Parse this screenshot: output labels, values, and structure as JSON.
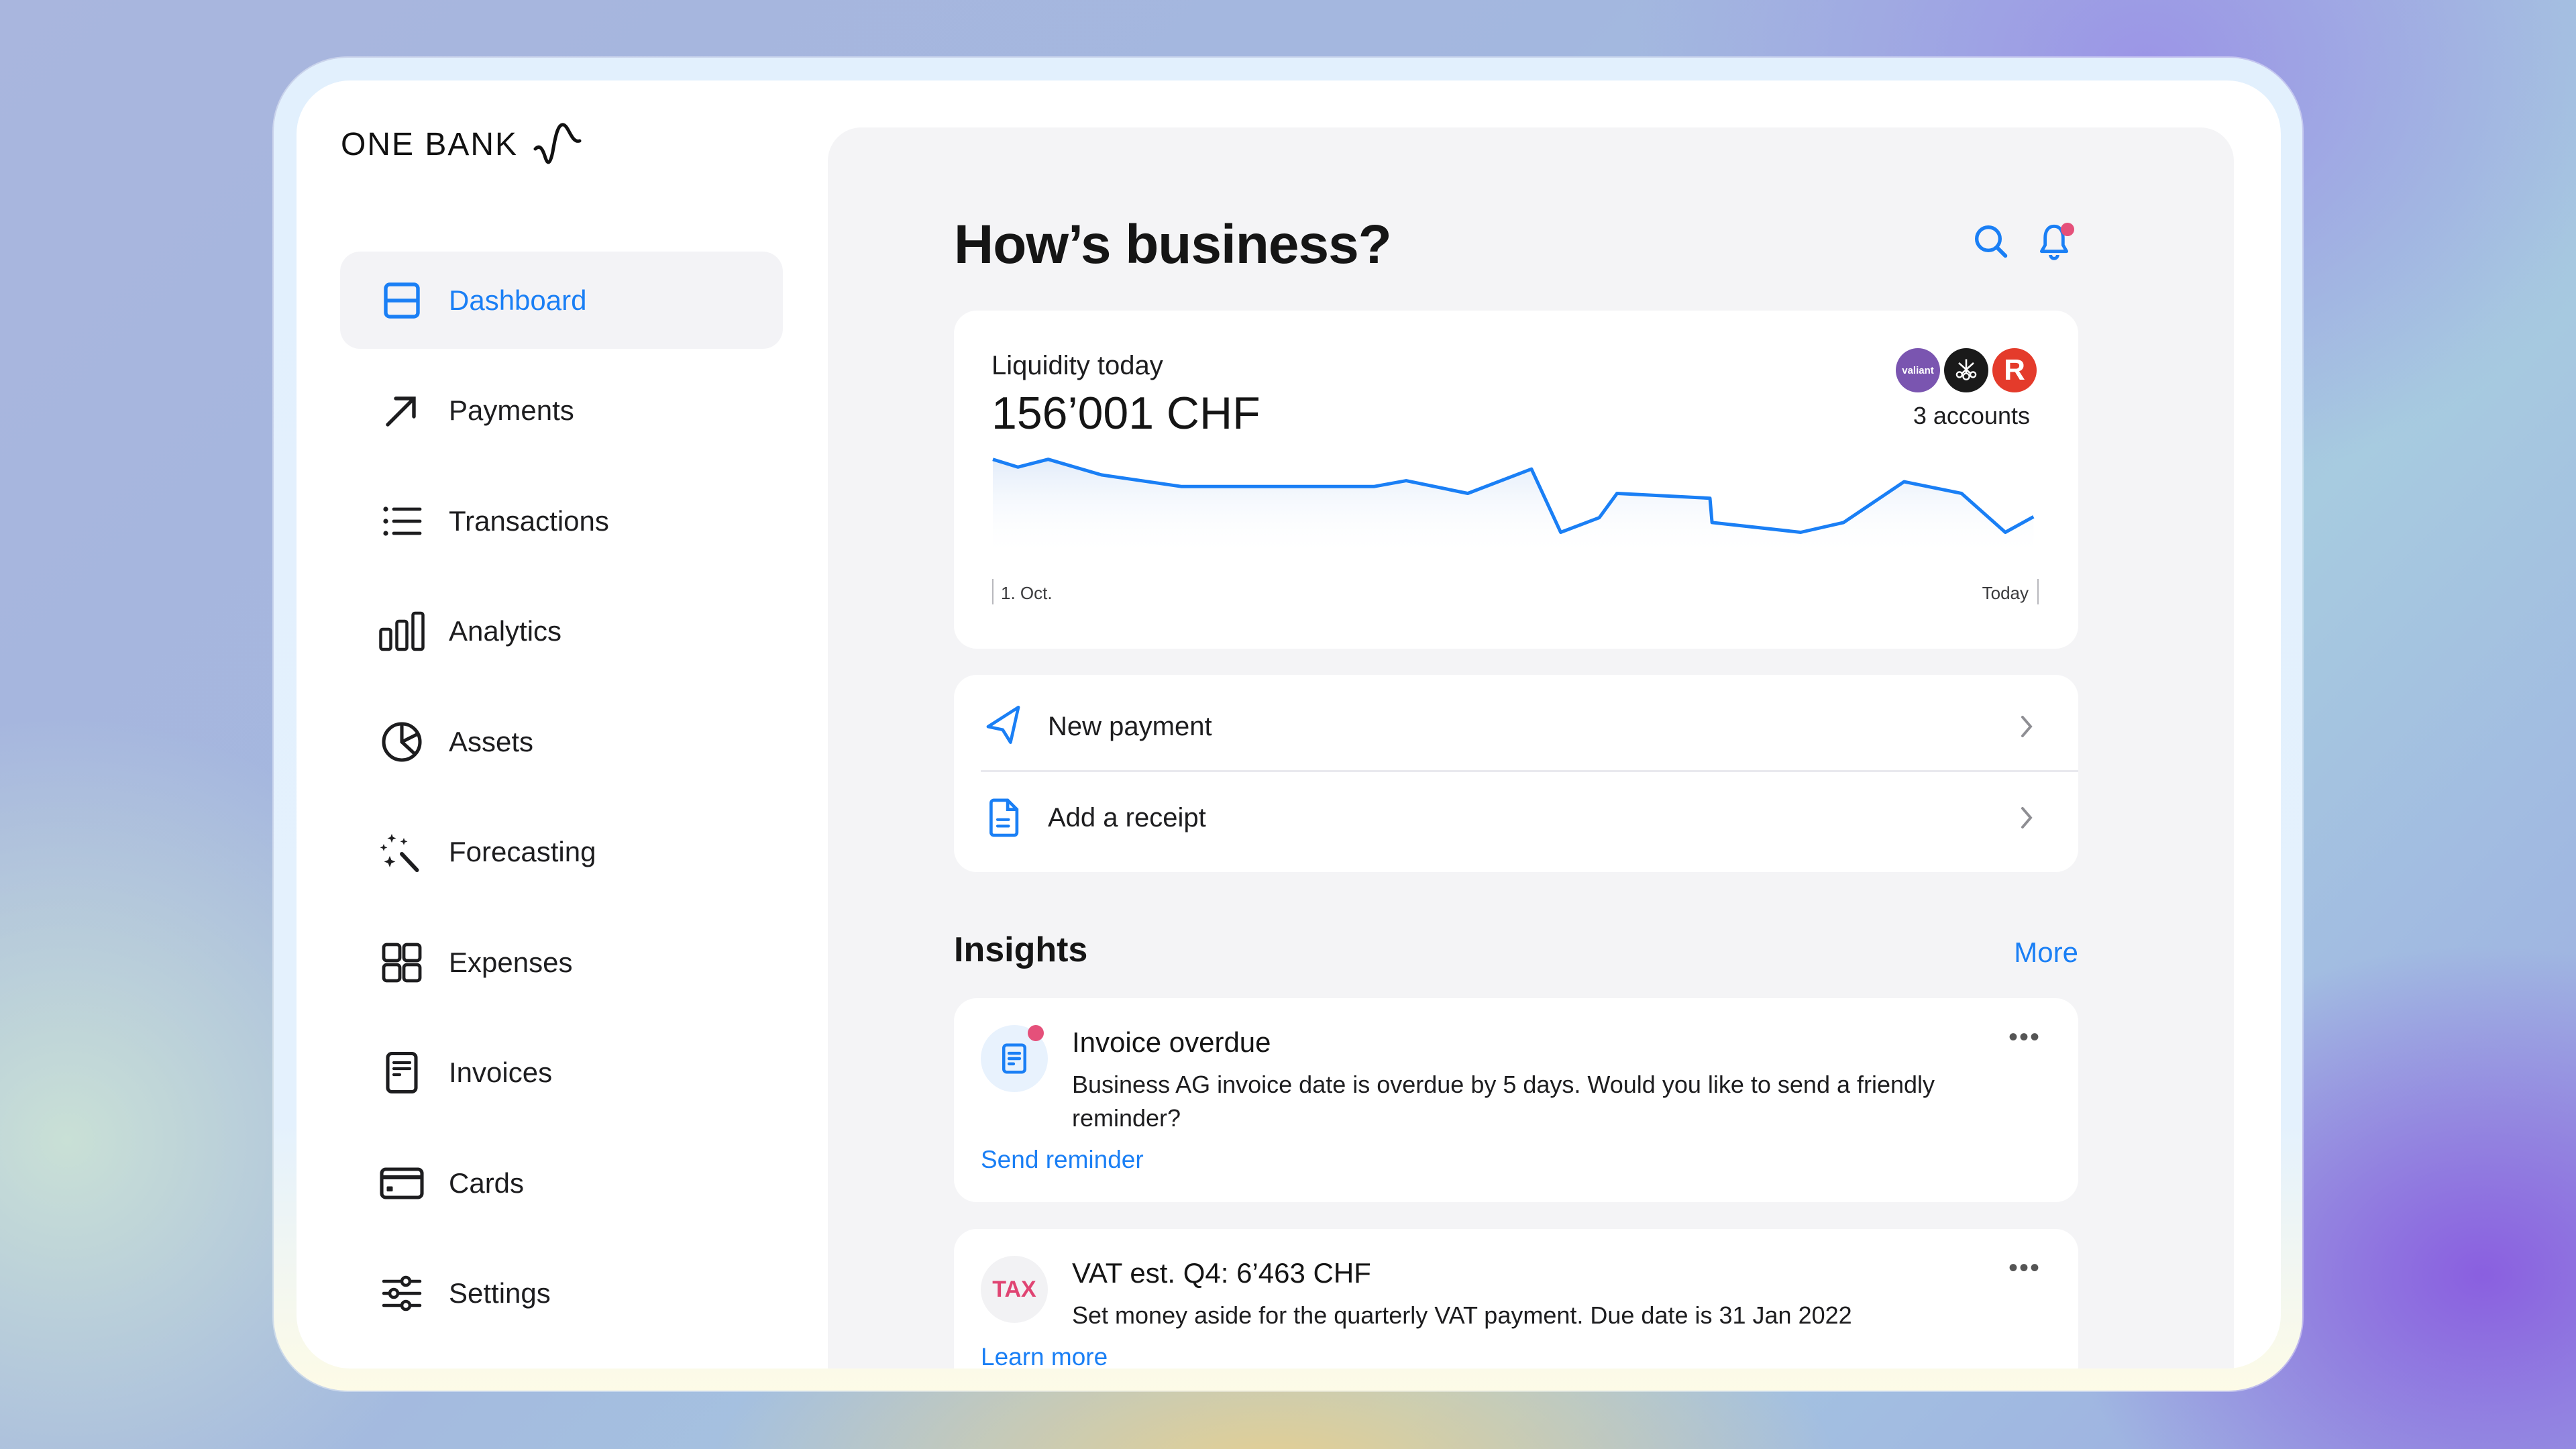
{
  "app": {
    "brand": "ONE BANK"
  },
  "sidebar": {
    "items": [
      {
        "label": "Dashboard",
        "icon": "dashboard-icon",
        "active": true
      },
      {
        "label": "Payments",
        "icon": "arrow-up-right-icon"
      },
      {
        "label": "Transactions",
        "icon": "list-icon"
      },
      {
        "label": "Analytics",
        "icon": "bar-chart-icon"
      },
      {
        "label": "Assets",
        "icon": "pie-chart-icon"
      },
      {
        "label": "Forecasting",
        "icon": "magic-wand-icon"
      },
      {
        "label": "Expenses",
        "icon": "grid-icon"
      },
      {
        "label": "Invoices",
        "icon": "document-icon"
      },
      {
        "label": "Cards",
        "icon": "credit-card-icon"
      },
      {
        "label": "Settings",
        "icon": "sliders-icon"
      }
    ]
  },
  "header": {
    "title": "How’s business?"
  },
  "liquidity": {
    "label": "Liquidity today",
    "value": "156’001 CHF",
    "accounts_label": "3 accounts",
    "banks": [
      {
        "name": "valiant",
        "label": "valiant",
        "color": "#7a55b0"
      },
      {
        "name": "ubs",
        "label": "",
        "color": "#1a1a1a"
      },
      {
        "name": "raiffeisen",
        "label": "R",
        "color": "#e43b2b"
      }
    ]
  },
  "chart_data": {
    "type": "area",
    "title": "Liquidity today",
    "x_start_label": "1. Oct.",
    "x_end_label": "Today",
    "xlabel": "",
    "ylabel": "",
    "grid": false,
    "ylim": [
      0,
      100
    ],
    "x": [
      0,
      2.4,
      5.3,
      10.4,
      18.1,
      36.5,
      39.6,
      45.5,
      51.6,
      54.4,
      58.1,
      59.8,
      68.7,
      68.9,
      77.4,
      81.5,
      87.3,
      92.8,
      97.0,
      99.7
    ],
    "values": [
      94,
      86,
      94,
      78,
      66,
      66,
      72,
      59,
      84,
      19,
      34,
      59,
      54,
      29,
      19,
      29,
      71,
      59,
      19,
      35
    ],
    "line_color": "#1a7ff5"
  },
  "actions": [
    {
      "label": "New payment",
      "icon": "send-icon"
    },
    {
      "label": "Add a receipt",
      "icon": "receipt-icon"
    }
  ],
  "insights": {
    "title": "Insights",
    "more_label": "More",
    "items": [
      {
        "title": "Invoice overdue",
        "body": "Business AG invoice date is overdue by 5 days. Would you like to send a friendly reminder?",
        "link": "Send reminder",
        "badge": "invoice-icon",
        "unread": true
      },
      {
        "title": "VAT est. Q4: 6’463 CHF",
        "body": "Set money aside for the quarterly VAT payment. Due date is 31 Jan 2022",
        "link": "Learn more",
        "badge": "TAX",
        "unread": false
      }
    ]
  },
  "colors": {
    "accent": "#1a7ff5",
    "alert": "#e5507a",
    "panel": "#f4f4f6"
  }
}
